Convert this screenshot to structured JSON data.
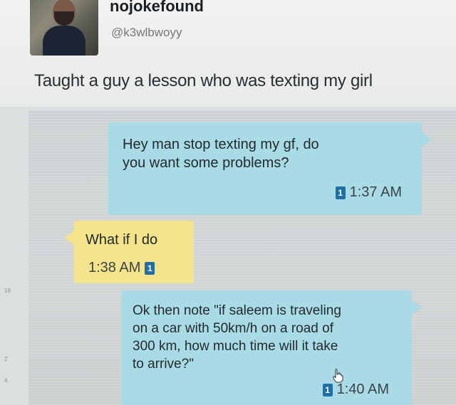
{
  "profile": {
    "display_name": "nojokefound",
    "handle": "@k3wlbwoyy"
  },
  "tweet": {
    "text": "Taught a guy a lesson who was texting my girl"
  },
  "messages": [
    {
      "direction": "sent",
      "text": "Hey man stop texting my gf, do\nyou want some problems?",
      "sim": "1",
      "time": "1:37 AM"
    },
    {
      "direction": "received",
      "text": "What if I do",
      "sim": "1",
      "time": "1:38 AM"
    },
    {
      "direction": "sent",
      "text": "Ok then note \"if saleem is traveling\non a car with 50km/h on a road of\n300 km, how much time will it take\nto arrive?\"",
      "sim": "1",
      "time": "1:40 AM"
    }
  ],
  "edge_marks": [
    "18",
    "2",
    "4"
  ],
  "colors": {
    "sent_bubble": "#a9dbe6",
    "received_bubble": "#f3e48b",
    "sim_badge": "#1f6fa5"
  },
  "icons": {
    "sim": "sim-1-icon",
    "cursor": "hand-cursor-icon"
  }
}
